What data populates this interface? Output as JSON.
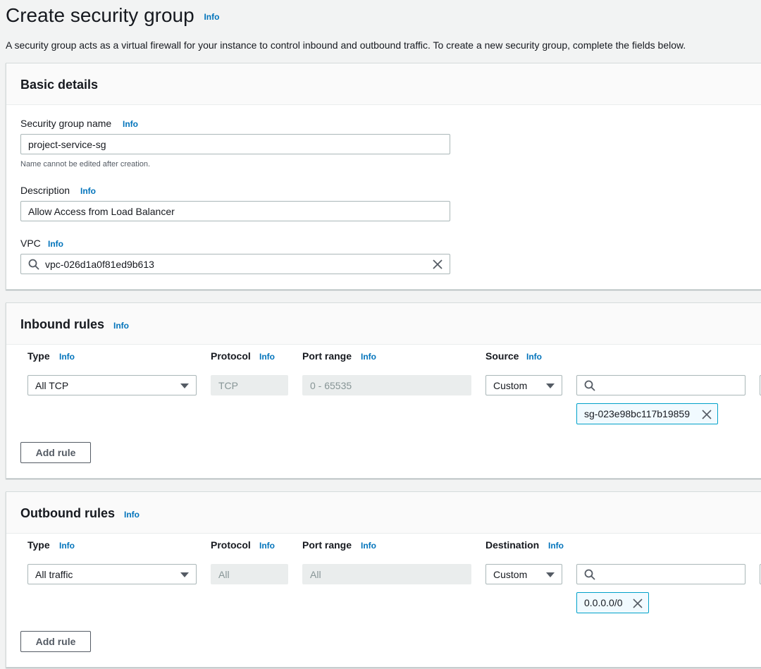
{
  "page": {
    "title": "Create security group",
    "title_info": "Info",
    "description": "A security group acts as a virtual firewall for your instance to control inbound and outbound traffic. To create a new security group, complete the fields below."
  },
  "basic_details": {
    "title": "Basic details",
    "name_label": "Security group name",
    "name_info": "Info",
    "name_value": "project-service-sg",
    "name_hint": "Name cannot be edited after creation.",
    "desc_label": "Description",
    "desc_info": "Info",
    "desc_value": "Allow Access from Load Balancer",
    "vpc_label": "VPC",
    "vpc_info": "Info",
    "vpc_value": "vpc-026d1a0f81ed9b613",
    "icons": {
      "search": "search-icon",
      "clear": "close-icon"
    }
  },
  "inbound": {
    "title": "Inbound rules",
    "title_info": "Info",
    "col_type": "Type",
    "col_type_info": "Info",
    "col_protocol": "Protocol",
    "col_protocol_info": "Info",
    "col_port": "Port range",
    "col_port_info": "Info",
    "col_source": "Source",
    "col_source_info": "Info",
    "rule": {
      "type": "All TCP",
      "protocol": "TCP",
      "port": "0 - 65535",
      "source_type": "Custom",
      "source_token": "sg-023e98bc117b19859"
    },
    "add_rule": "Add rule"
  },
  "outbound": {
    "title": "Outbound rules",
    "title_info": "Info",
    "col_type": "Type",
    "col_type_info": "Info",
    "col_protocol": "Protocol",
    "col_protocol_info": "Info",
    "col_port": "Port range",
    "col_port_info": "Info",
    "col_dest": "Destination",
    "col_dest_info": "Info",
    "rule": {
      "type": "All traffic",
      "protocol": "All",
      "port": "All",
      "dest_type": "Custom",
      "dest_token": "0.0.0.0/0"
    },
    "add_rule": "Add rule"
  },
  "colors": {
    "link": "#0073bb",
    "token_border": "#00a1c9",
    "background": "#f2f3f3"
  }
}
